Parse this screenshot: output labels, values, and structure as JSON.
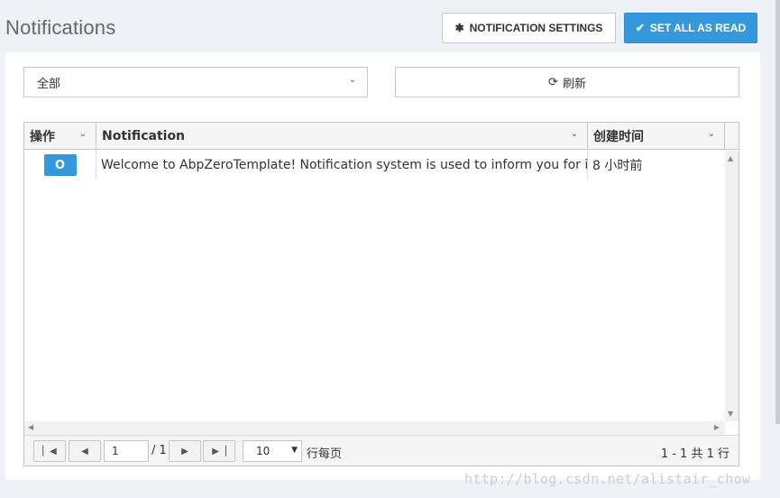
{
  "header": {
    "title": "Notifications",
    "settings_label": "NOTIFICATION SETTINGS",
    "read_all_label": "SET ALL AS READ",
    "accent": "#3598dc"
  },
  "filters": {
    "state_value": "全部",
    "refresh_label": "刷新"
  },
  "grid": {
    "columns": [
      "操作",
      "Notification",
      "创建时间"
    ],
    "rows": [
      {
        "action_glyph": "O",
        "notification": "Welcome to AbpZeroTemplate! Notification system is used to inform you for int...",
        "created": "8 小时前"
      }
    ]
  },
  "pager": {
    "current_page": "1",
    "total_pages": "/ 1",
    "page_size": "10",
    "per_page_label": "行每页",
    "summary": "1 - 1 共 1 行"
  },
  "watermark": "http://blog.csdn.net/alistair_chow"
}
